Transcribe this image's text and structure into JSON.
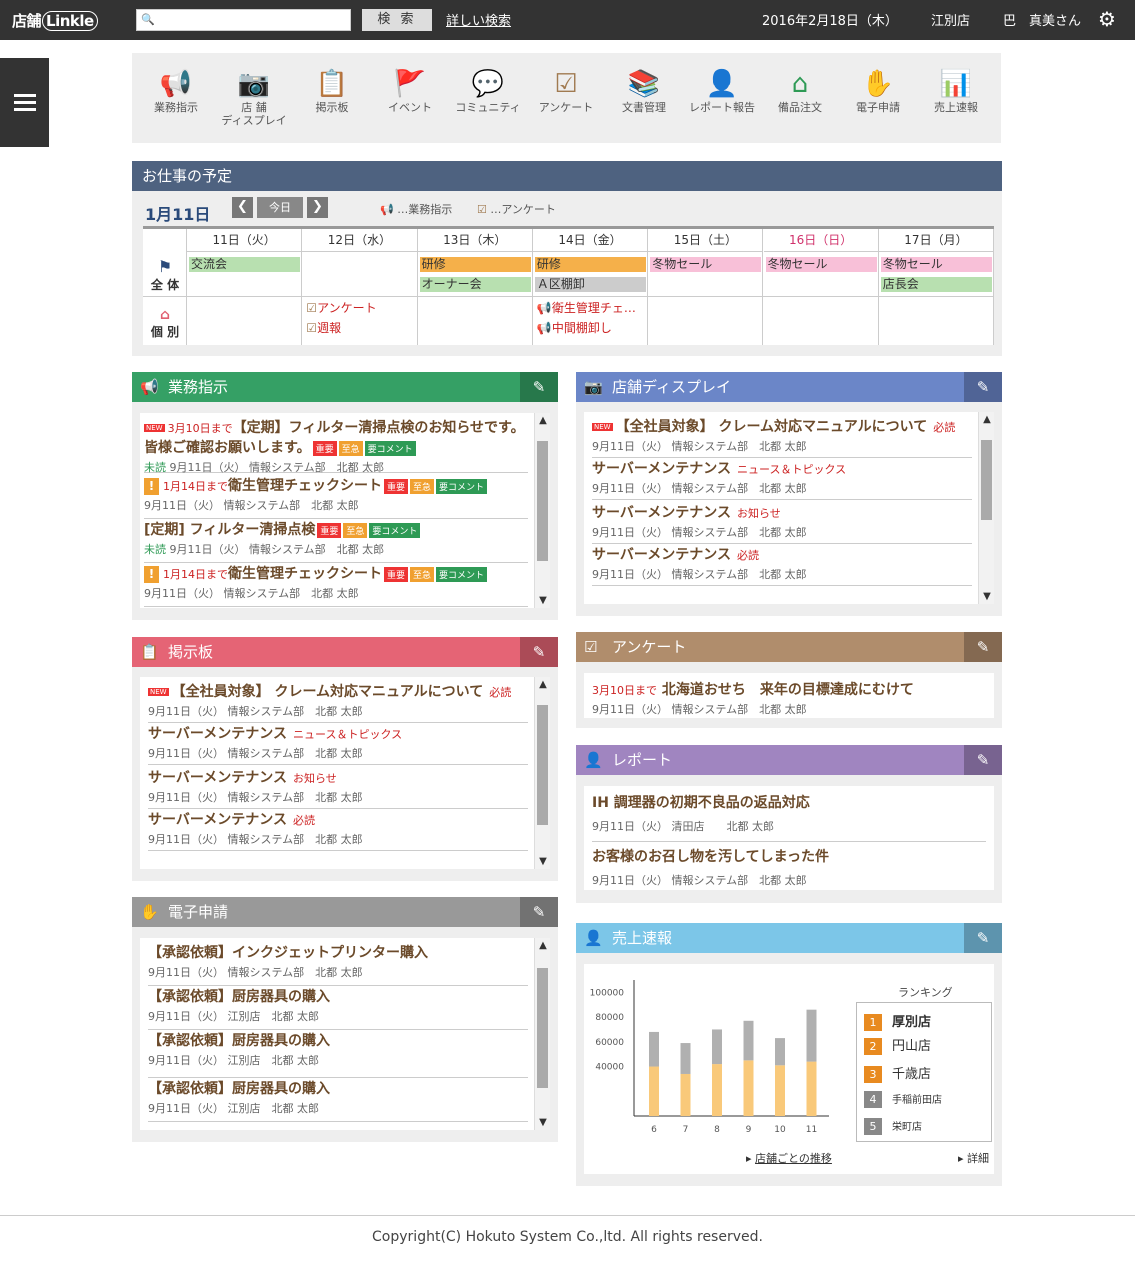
{
  "topbar": {
    "logo_main": "店舗",
    "logo_sub": "Linkle",
    "search_placeholder": "",
    "search_button": "検 索",
    "advanced_search": "詳しい検索",
    "date": "2016年2月18日（木）",
    "shop": "江別店",
    "user": "巴　真美さん"
  },
  "nav": [
    {
      "label": "業務指示",
      "icon": "megaphone-icon",
      "glyph": "📢",
      "color": "#2e9a55"
    },
    {
      "label": "店 舗\nディスプレイ",
      "icon": "camera-icon",
      "glyph": "📷",
      "color": "#5a7fc8"
    },
    {
      "label": "掲示板",
      "icon": "board-icon",
      "glyph": "📋",
      "color": "#e05a6a"
    },
    {
      "label": "イベント",
      "icon": "flag-icon",
      "glyph": "🚩",
      "color": "#2a4a7a"
    },
    {
      "label": "コミュニティ",
      "icon": "chat-icon",
      "glyph": "💬",
      "color": "#f0a030"
    },
    {
      "label": "アンケート",
      "icon": "checkbox-icon",
      "glyph": "☑",
      "color": "#a07a50"
    },
    {
      "label": "文書管理",
      "icon": "books-icon",
      "glyph": "📚",
      "color": "#f29aa8"
    },
    {
      "label": "レポート報告",
      "icon": "operator-icon",
      "glyph": "👤",
      "color": "#9a6ab0"
    },
    {
      "label": "備品注文",
      "icon": "hanger-icon",
      "glyph": "⌂",
      "color": "#2e9a55"
    },
    {
      "label": "電子申請",
      "icon": "stamp-icon",
      "glyph": "✋",
      "color": "#777"
    },
    {
      "label": "売上速報",
      "icon": "bar-chart-icon",
      "glyph": "📊",
      "color": "#5ab0e0"
    }
  ],
  "schedule": {
    "title": "お仕事の予定",
    "month": "1月11日",
    "prev": "❮",
    "next": "❯",
    "today": "今日",
    "legend_task": "…業務指示",
    "legend_survey": "…アンケート",
    "row_all": "全 体",
    "row_indiv": "個 別",
    "days": [
      {
        "label": "11日（火）",
        "holiday": false
      },
      {
        "label": "12日（水）",
        "holiday": false
      },
      {
        "label": "13日（木）",
        "holiday": false
      },
      {
        "label": "14日（金）",
        "holiday": false
      },
      {
        "label": "15日（土）",
        "holiday": false
      },
      {
        "label": "16日（日）",
        "holiday": true
      },
      {
        "label": "17日（月）",
        "holiday": false
      }
    ],
    "events_all": [
      {
        "day": 0,
        "row": 0,
        "text": "交流会",
        "color": "#b8e0b0"
      },
      {
        "day": 2,
        "row": 0,
        "text": "研修",
        "color": "#f5b04a"
      },
      {
        "day": 3,
        "row": 0,
        "text": "研修",
        "color": "#f5b04a"
      },
      {
        "day": 4,
        "row": 0,
        "text": "冬物セール",
        "color": "#f8c0d8"
      },
      {
        "day": 5,
        "row": 0,
        "text": "冬物セール",
        "color": "#f8c0d8"
      },
      {
        "day": 6,
        "row": 0,
        "text": "冬物セール",
        "color": "#f8c0d8"
      },
      {
        "day": 2,
        "row": 1,
        "text": "オーナー会",
        "color": "#b8e0b0"
      },
      {
        "day": 3,
        "row": 1,
        "text": "Ａ区棚卸",
        "color": "#ccc"
      },
      {
        "day": 6,
        "row": 1,
        "text": "店長会",
        "color": "#b8e0b0"
      }
    ],
    "events_indiv": [
      {
        "day": 1,
        "row": 0,
        "text": "アンケート",
        "kind": "survey"
      },
      {
        "day": 1,
        "row": 1,
        "text": "週報",
        "kind": "survey"
      },
      {
        "day": 3,
        "row": 0,
        "text": "衛生管理チェ…",
        "kind": "task"
      },
      {
        "day": 3,
        "row": 1,
        "text": "中間棚卸し",
        "kind": "task"
      }
    ]
  },
  "gyomu": {
    "title": "業務指示",
    "items": [
      {
        "due": "3月10日まで",
        "title": "【定期】フィルター清掃点検のお知らせです。",
        "title2": "皆様ご確認お願いします。",
        "new": true,
        "badges": true,
        "unread": "未読",
        "meta": "9月11日（火） 情報システム部　北都 太郎"
      },
      {
        "due": "1月14日まで",
        "title": "衛生管理チェックシート",
        "warn": true,
        "badges": true,
        "meta": "9月11日（火） 情報システム部　北都 太郎"
      },
      {
        "title": "[定期] フィルター清掃点検",
        "badges": true,
        "unread": "未読",
        "meta": "9月11日（火） 情報システム部　北都 太郎"
      },
      {
        "due": "1月14日まで",
        "title": "衛生管理チェックシート",
        "warn": true,
        "badges": true,
        "meta": "9月11日（火） 情報システム部　北都 太郎"
      }
    ],
    "badge_imp": "重要",
    "badge_urg": "至急",
    "badge_com": "要コメント",
    "new_label": "NEW"
  },
  "display": {
    "title": "店舗ディスプレイ",
    "items": [
      {
        "title": "【全社員対象】 クレーム対応マニュアルについて",
        "tag": "必読",
        "new": true,
        "meta": "9月11日（火） 情報システム部　北都 太郎"
      },
      {
        "title": "サーバーメンテナンス",
        "tag": "ニュース＆トピックス",
        "meta": "9月11日（火） 情報システム部　北都 太郎"
      },
      {
        "title": "サーバーメンテナンス",
        "tag": "お知らせ",
        "meta": "9月11日（火） 情報システム部　北都 太郎"
      },
      {
        "title": "サーバーメンテナンス",
        "tag": "必読",
        "meta": "9月11日（火） 情報システム部　北都 太郎"
      }
    ]
  },
  "keiji": {
    "title": "掲示板",
    "items": [
      {
        "title": "【全社員対象】 クレーム対応マニュアルについて",
        "tag": "必読",
        "new": true,
        "meta": "9月11日（火） 情報システム部　北都 太郎"
      },
      {
        "title": "サーバーメンテナンス",
        "tag": "ニュース＆トピックス",
        "meta": "9月11日（火） 情報システム部　北都 太郎"
      },
      {
        "title": "サーバーメンテナンス",
        "tag": "お知らせ",
        "meta": "9月11日（火） 情報システム部　北都 太郎"
      },
      {
        "title": "サーバーメンテナンス",
        "tag": "必読",
        "meta": "9月11日（火） 情報システム部　北都 太郎"
      }
    ]
  },
  "survey": {
    "title": "アンケート",
    "items": [
      {
        "due": "3月10日まで",
        "title": "北海道おせち　来年の目標達成にむけて",
        "meta": "9月11日（火） 情報システム部　北都 太郎"
      }
    ]
  },
  "report": {
    "title": "レポート",
    "items": [
      {
        "title": "IH 調理器の初期不良品の返品対応",
        "meta": "9月11日（火） 清田店　　北都 太郎"
      },
      {
        "title": "お客様のお召し物を汚してしまった件",
        "meta": "9月11日（火） 情報システム部　北都 太郎"
      }
    ]
  },
  "denshi": {
    "title": "電子申請",
    "items": [
      {
        "title": "【承認依頼】インクジェットプリンター購入",
        "meta": "9月11日（火） 情報システム部　北都 太郎"
      },
      {
        "title": "【承認依頼】厨房器具の購入",
        "meta": "9月11日（火） 江別店　北都 太郎"
      },
      {
        "title": "【承認依頼】厨房器具の購入",
        "meta": "9月11日（火） 江別店　北都 太郎"
      },
      {
        "title": "【承認依頼】厨房器具の購入",
        "meta": "9月11日（火） 江別店　北都 太郎"
      }
    ]
  },
  "sales": {
    "title": "売上速報",
    "ranking_title": "ランキング",
    "ranking": [
      {
        "rank": "1",
        "name": "厚別店",
        "color": "#e88a20",
        "big": true
      },
      {
        "rank": "2",
        "name": "円山店",
        "color": "#e88a20",
        "big": false
      },
      {
        "rank": "3",
        "name": "千歳店",
        "color": "#e88a20",
        "big": false
      },
      {
        "rank": "4",
        "name": "手稲前田店",
        "color": "#888",
        "big": false
      },
      {
        "rank": "5",
        "name": "栄町店",
        "color": "#888",
        "big": false
      }
    ],
    "link_trend": "店舗ごとの推移",
    "link_detail": "詳細"
  },
  "chart_data": {
    "type": "bar",
    "stacked": true,
    "categories": [
      "6",
      "7",
      "8",
      "9",
      "10",
      "11"
    ],
    "series": [
      {
        "values": [
          40000,
          34000,
          42000,
          45000,
          41000,
          44000
        ],
        "color": "#f9c97a"
      },
      {
        "values": [
          28000,
          25000,
          28000,
          32000,
          22000,
          42000
        ],
        "color": "#b0b0b0"
      }
    ],
    "yticks": [
      "100000",
      "80000",
      "60000",
      "40000"
    ],
    "ylim": [
      0,
      110000
    ]
  },
  "footer": "Copyright(C) Hokuto System Co.,ltd. All rights reserved.",
  "colors": {
    "gyomu": "#35a065",
    "display": "#6b86c8",
    "keiji": "#e56475",
    "survey": "#b08d6c",
    "report": "#a085c0",
    "denshi": "#999999",
    "sales": "#7cc6e8",
    "schedule": "#4e6280"
  }
}
